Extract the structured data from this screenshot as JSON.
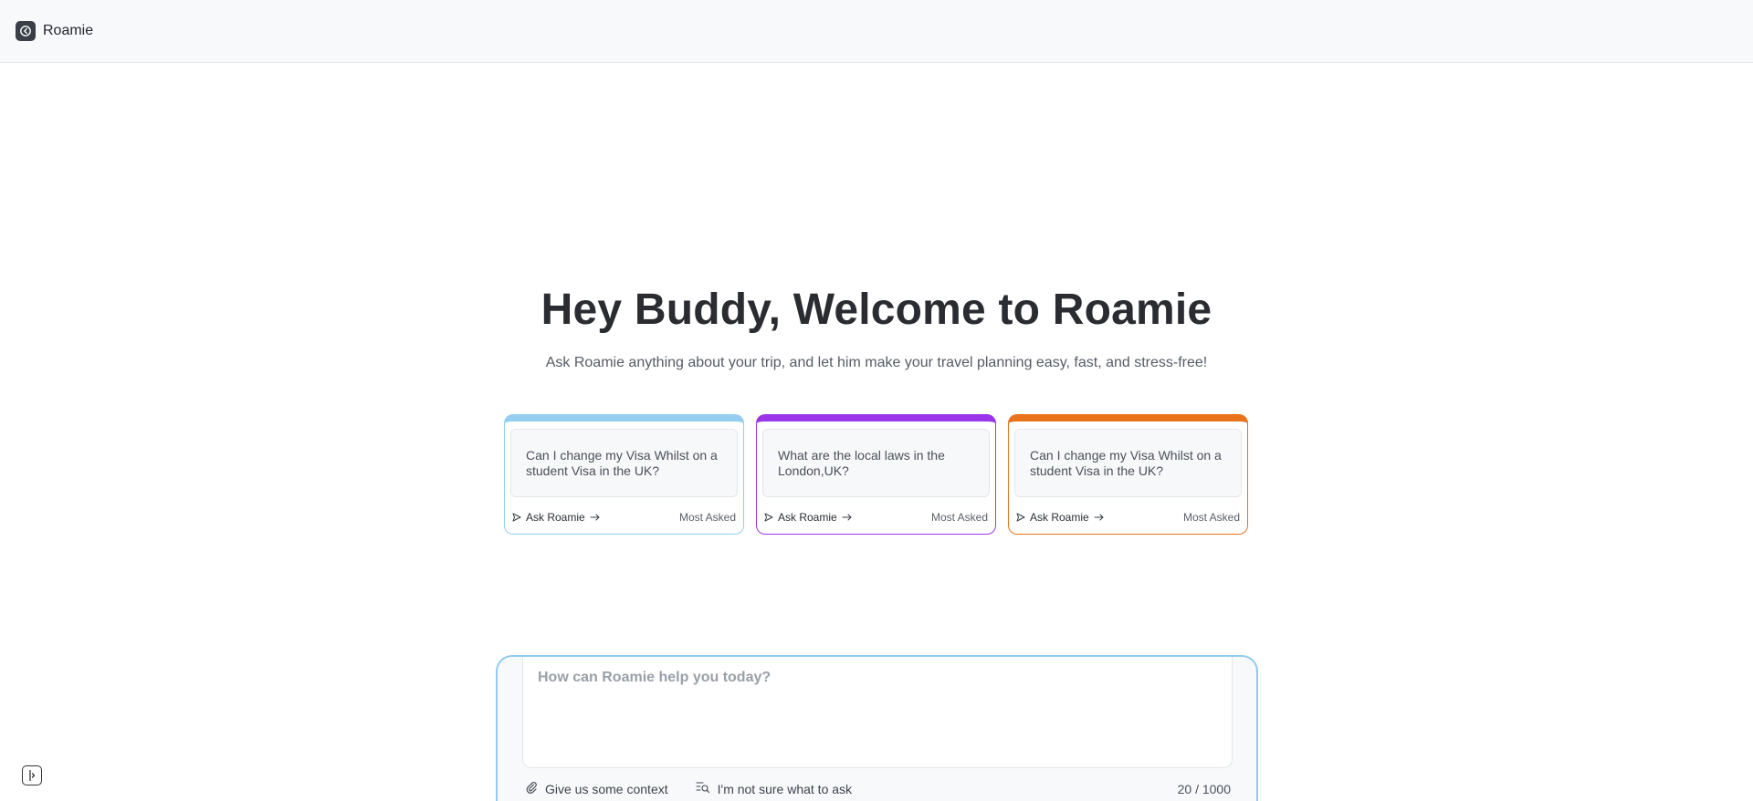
{
  "header": {
    "brand": "Roamie",
    "logo_icon": "roamie-logo-icon"
  },
  "hero": {
    "title": "Hey Buddy, Welcome to Roamie",
    "subtitle": "Ask Roamie anything about your trip, and let him make your travel planning easy, fast, and stress-free!"
  },
  "cards": [
    {
      "question": "Can I change my Visa Whilst on a student Visa in the UK?",
      "action": "Ask Roamie",
      "tag": "Most Asked",
      "accent": "#93cdef"
    },
    {
      "question": "What are the local laws in the London,UK?",
      "action": "Ask Roamie",
      "tag": "Most Asked",
      "accent": "#9b35ea"
    },
    {
      "question": "Can I change my Visa Whilst on a student Visa in the UK?",
      "action": "Ask Roamie",
      "tag": "Most Asked",
      "accent": "#e8731b"
    }
  ],
  "composer": {
    "placeholder": "How can Roamie help you today?",
    "value": "",
    "context_label": "Give us some context",
    "suggest_label": "I'm not sure what to ask",
    "char_count": "20 / 1000",
    "accent": "#8fcbf0"
  },
  "sidebar": {
    "toggle_icon": "sidebar-toggle-icon"
  }
}
